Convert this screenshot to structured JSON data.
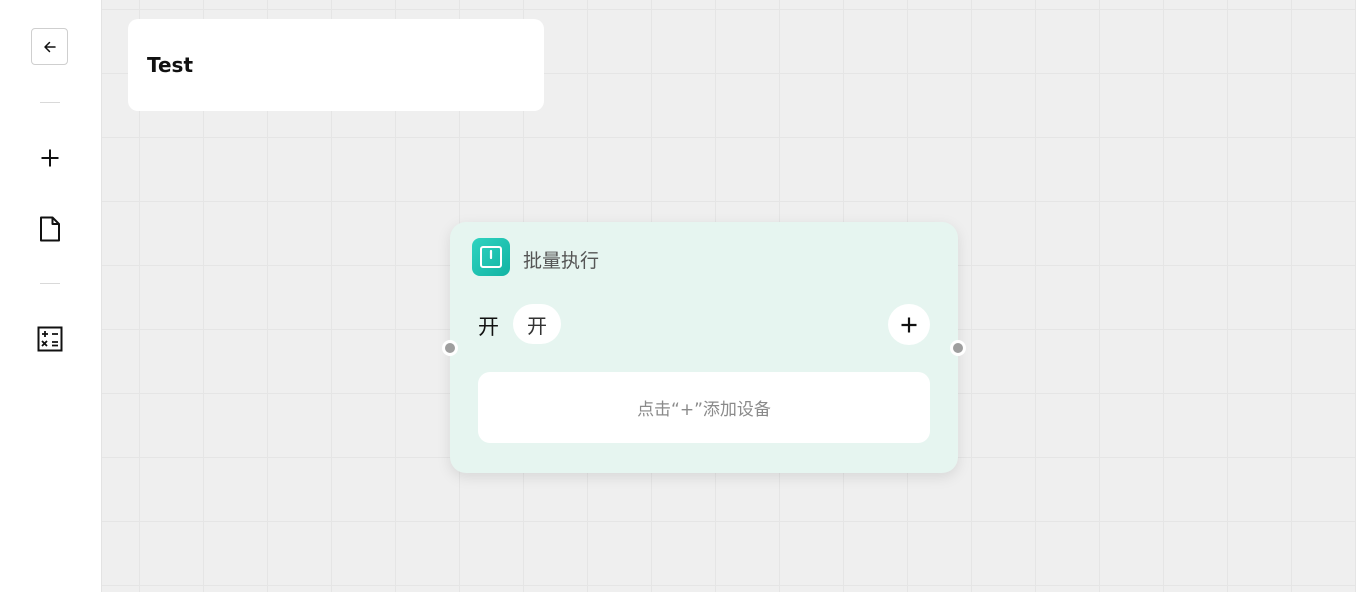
{
  "sidebar": {
    "back_icon": "arrow-left-icon",
    "tools": [
      {
        "icon": "plus-icon"
      },
      {
        "icon": "file-icon"
      },
      {
        "icon": "calculator-icon"
      }
    ]
  },
  "header": {
    "title": "Test"
  },
  "node": {
    "icon": "batch-execute-icon",
    "title": "批量执行",
    "state_label": "开",
    "state_value": "开",
    "add_icon": "plus-icon",
    "empty_hint": "点击“+”添加设备",
    "accent_color": "#1ec6b4",
    "background_color": "#e6f5f0"
  }
}
